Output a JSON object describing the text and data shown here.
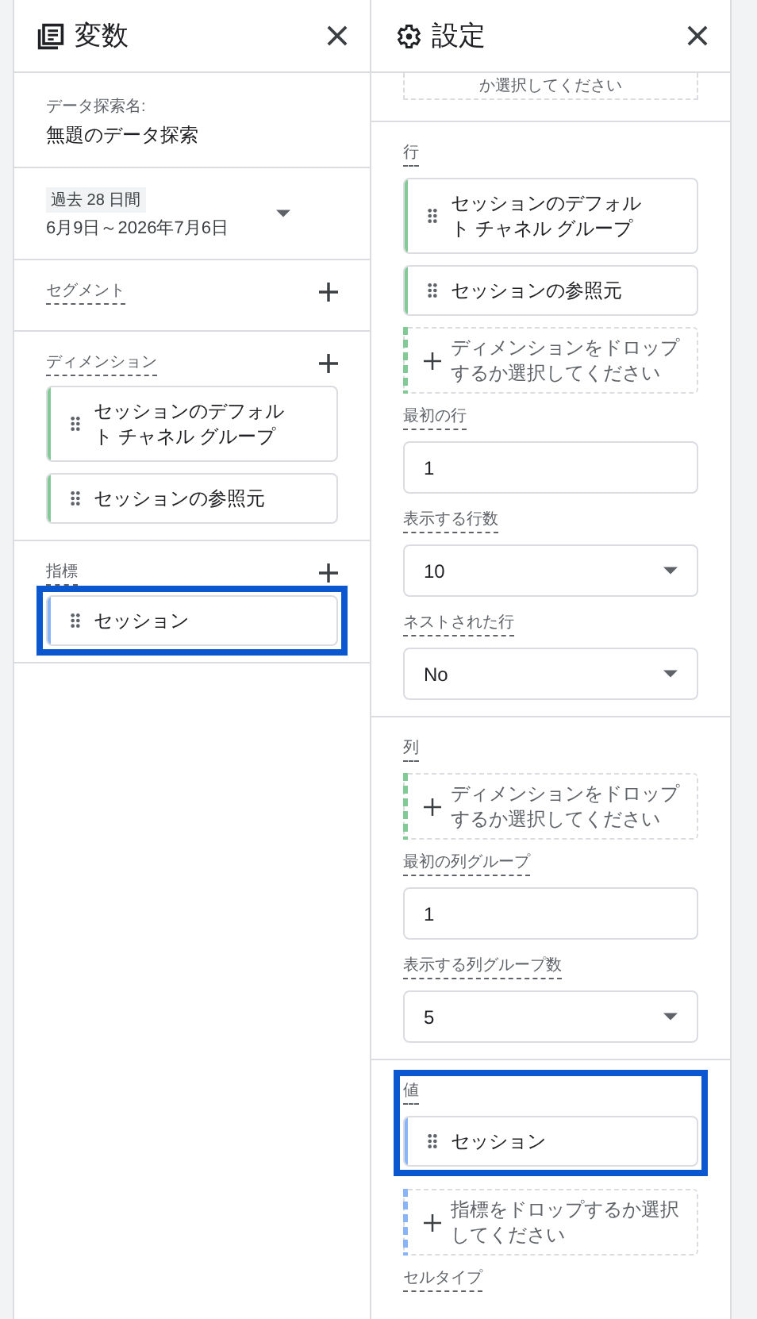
{
  "variables_panel": {
    "title": "変数",
    "explore_name_label": "データ探索名:",
    "explore_name": "無題のデータ探索",
    "date_badge": "過去 28 日間",
    "date_range": "6月9日～2026年7月6日",
    "sections": [
      {
        "label": "セグメント",
        "highlighted": false
      },
      {
        "label": "ディメンション",
        "highlighted": false,
        "items": [
          {
            "name": "セッションのデフォルト チャネル グループ",
            "color": "#81c995"
          },
          {
            "name": "セッションの参照元",
            "color": "#81c995"
          }
        ]
      },
      {
        "label": "指標",
        "highlighted": true,
        "items": [
          {
            "name": "セッション",
            "color": "#8ab4f8"
          }
        ]
      }
    ]
  },
  "settings_panel": {
    "title": "設定",
    "top_drop_text": "か選択してください",
    "sections": [
      {
        "highlighted": false,
        "blocks": [
          {
            "kind": "label",
            "text": "行"
          },
          {
            "kind": "chip",
            "text": "セッションのデフォルト チャネル グループ",
            "color": "#81c995"
          },
          {
            "kind": "chip",
            "text": "セッションの参照元",
            "color": "#81c995"
          },
          {
            "kind": "drop",
            "text": "ディメンションをドロップするか選択してください",
            "color": "#81c995"
          },
          {
            "kind": "label",
            "text": "最初の行"
          },
          {
            "kind": "input",
            "text": "1"
          },
          {
            "kind": "label",
            "text": "表示する行数"
          },
          {
            "kind": "select",
            "text": "10"
          },
          {
            "kind": "label",
            "text": "ネストされた行"
          },
          {
            "kind": "select",
            "text": "No"
          }
        ]
      },
      {
        "highlighted": false,
        "blocks": [
          {
            "kind": "label",
            "text": "列"
          },
          {
            "kind": "drop",
            "text": "ディメンションをドロップするか選択してください",
            "color": "#81c995"
          },
          {
            "kind": "label",
            "text": "最初の列グループ"
          },
          {
            "kind": "input",
            "text": "1"
          },
          {
            "kind": "label",
            "text": "表示する列グループ数"
          },
          {
            "kind": "select",
            "text": "5"
          }
        ]
      },
      {
        "highlighted": true,
        "blocks": [
          {
            "kind": "label",
            "text": "値"
          },
          {
            "kind": "chip",
            "text": "セッション",
            "color": "#8ab4f8"
          }
        ]
      },
      {
        "highlighted": false,
        "blocks": [
          {
            "kind": "drop",
            "text": "指標をドロップするか選択してください",
            "color": "#8ab4f8"
          },
          {
            "kind": "label",
            "text": "セルタイプ"
          }
        ]
      }
    ]
  }
}
